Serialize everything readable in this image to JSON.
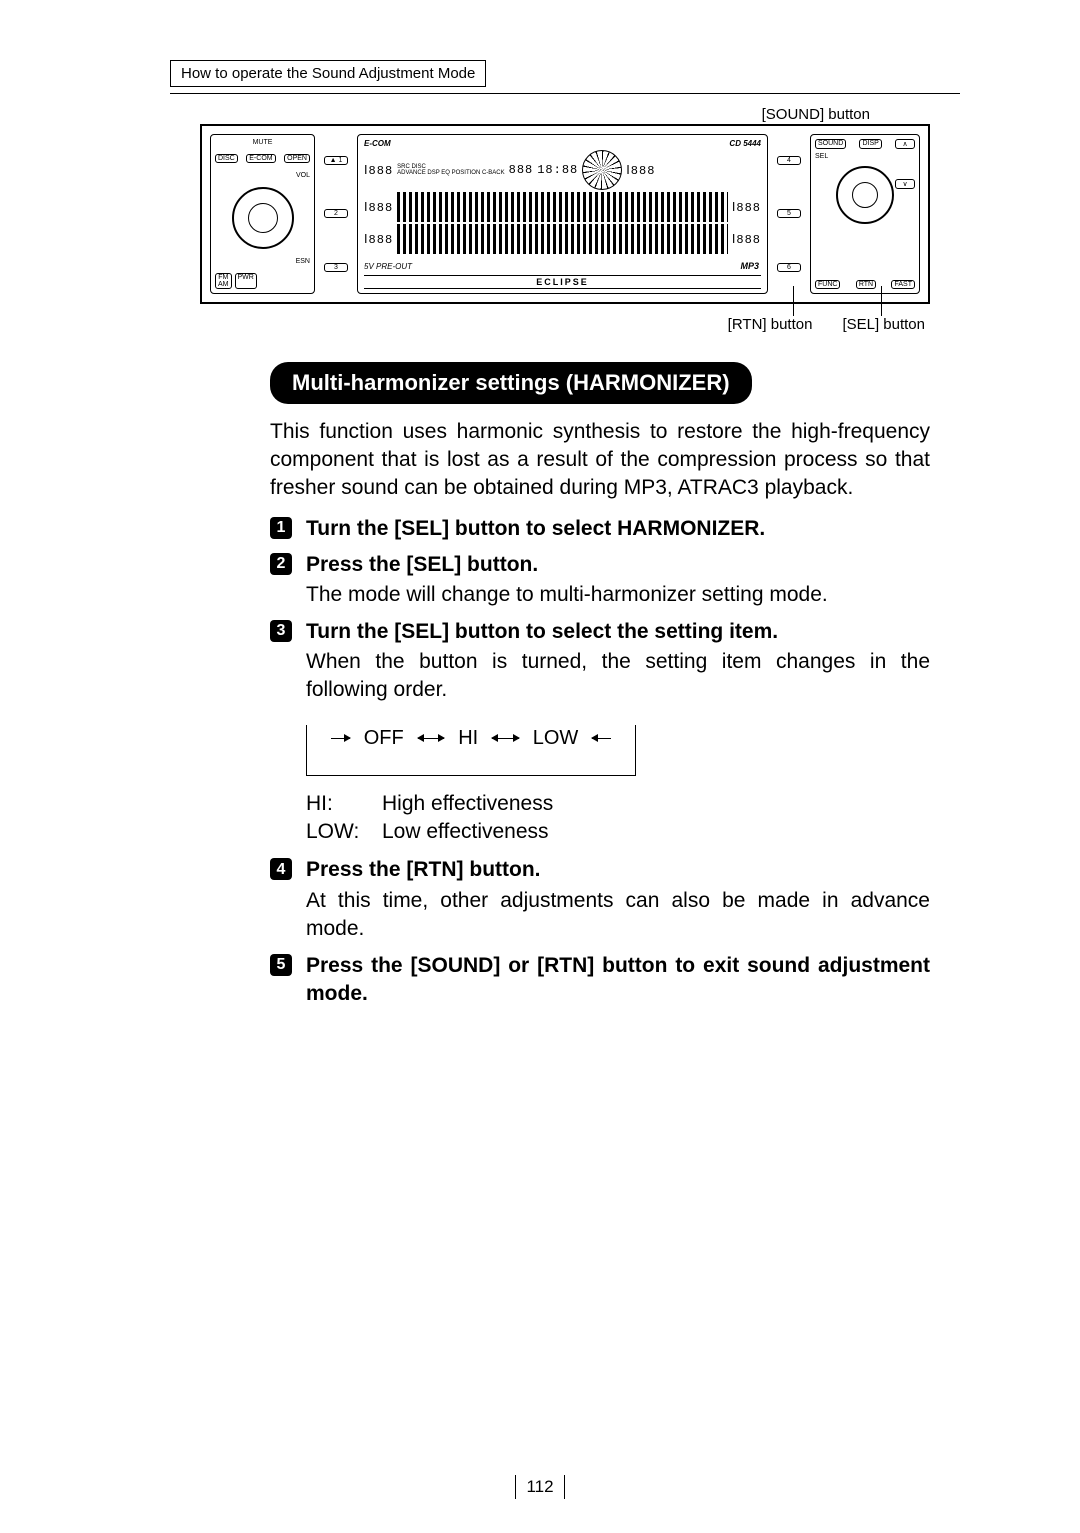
{
  "header_tag": "How to operate the Sound Adjustment Mode",
  "labels": {
    "sound_button": "[SOUND] button",
    "rtn_button": "[RTN] button",
    "sel_button": "[SEL] button"
  },
  "device": {
    "brand_left": "E-COM",
    "brand_right": "CD 5444",
    "eclipse": "ECLIPSE",
    "preout": "5V PRE-OUT",
    "mp3": "MP3",
    "left_top": {
      "mute": "MUTE",
      "disc": "DISC",
      "ecom": "E-COM",
      "open": "OPEN",
      "vol": "VOL",
      "esn": "ESN"
    },
    "left_bottom": {
      "fm": "FM",
      "am": "AM",
      "pwr": "PWR"
    },
    "num_left": [
      "▲  1",
      "2",
      "3"
    ],
    "num_right": [
      "4",
      "5",
      "6"
    ],
    "right_top": {
      "sound": "SOUND",
      "disp": "DISP",
      "seek_up": "∧",
      "sel": "SEL"
    },
    "right_bottom": {
      "func": "FUNC",
      "rtn": "RTN",
      "fast": "FAST",
      "seek_dn": "∨"
    },
    "seg_a": "Ⅰ888",
    "seg_b": "888",
    "seg_c": "18:88",
    "seg_d": "Ⅰ888",
    "mini_labels": "SRC  DISC",
    "mini_boxes": "ADVANCE  DSP  EQ  POSITION  C-BACK"
  },
  "section_title": "Multi-harmonizer settings (HARMONIZER)",
  "intro": "This function uses harmonic synthesis to restore the high-frequency component that is lost as a result of the compression process so that fresher sound can be obtained during MP3, ATRAC3 playback.",
  "steps": [
    {
      "n": "1",
      "title": "Turn the [SEL] button to select HARMONIZER."
    },
    {
      "n": "2",
      "title": "Press the [SEL] button.",
      "body": "The mode will change to multi-harmonizer setting mode."
    },
    {
      "n": "3",
      "title": "Turn the [SEL] button to select the setting item.",
      "body": "When the button is turned, the setting item changes in the following order."
    },
    {
      "n": "4",
      "title": "Press the [RTN] button.",
      "body": "At this time, other adjustments can also be made in advance mode."
    },
    {
      "n": "5",
      "title": "Press the [SOUND] or [RTN] button to exit sound adjustment mode."
    }
  ],
  "cycle": {
    "a": "OFF",
    "b": "HI",
    "c": "LOW"
  },
  "eff": [
    {
      "k": "HI:",
      "v": "High effectiveness"
    },
    {
      "k": "LOW:",
      "v": "Low effectiveness"
    }
  ],
  "page_number": "112"
}
